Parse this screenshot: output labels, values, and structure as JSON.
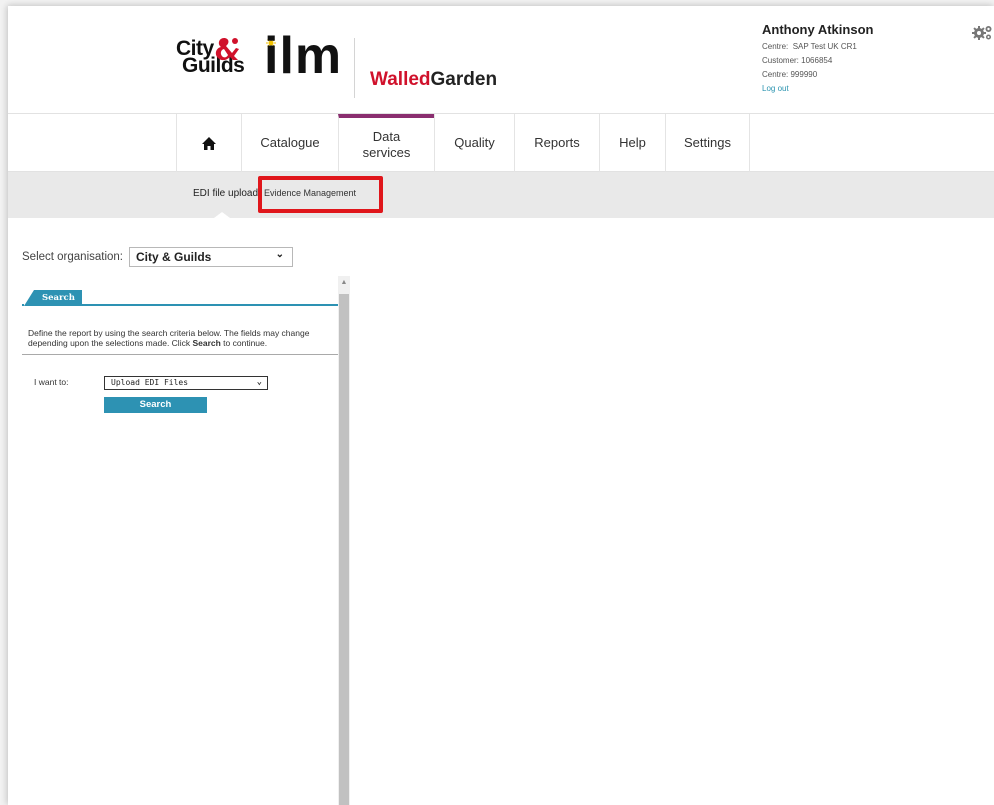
{
  "header": {
    "logo_city": "City",
    "logo_guilds": "Guilds",
    "logo_ilm": "ilm",
    "logo_walled": "Walled",
    "logo_garden": "Garden"
  },
  "user": {
    "name": "Anthony Atkinson",
    "centre_label": "Centre:",
    "centre_value": "SAP Test UK CR1",
    "customer_label": "Customer:",
    "customer_value": "1066854",
    "centre2_label": "Centre:",
    "centre2_value": "999990",
    "logout": "Log out"
  },
  "nav": {
    "items": [
      {
        "label": "Catalogue"
      },
      {
        "label_line1": "Data",
        "label_line2": "services"
      },
      {
        "label": "Quality"
      },
      {
        "label": "Reports"
      },
      {
        "label": "Help"
      },
      {
        "label": "Settings"
      }
    ]
  },
  "subnav": {
    "items": [
      {
        "label": "EDI file upload"
      },
      {
        "label": "Evidence Management"
      }
    ]
  },
  "org": {
    "label": "Select organisation:",
    "value": "City & Guilds"
  },
  "search_panel": {
    "tab_label": "Search",
    "description_pre": "Define the report by using the search criteria below. The fields may change depending upon the selections made. Click ",
    "description_bold": "Search",
    "description_post": " to continue.",
    "want_label": "I want to:",
    "want_value": "Upload EDI Files",
    "search_button": "Search"
  },
  "colors": {
    "accent_teal": "#2d92b3",
    "nav_active": "#8a2e6f",
    "brand_red": "#d0112b",
    "highlight_red": "#e0161b"
  }
}
